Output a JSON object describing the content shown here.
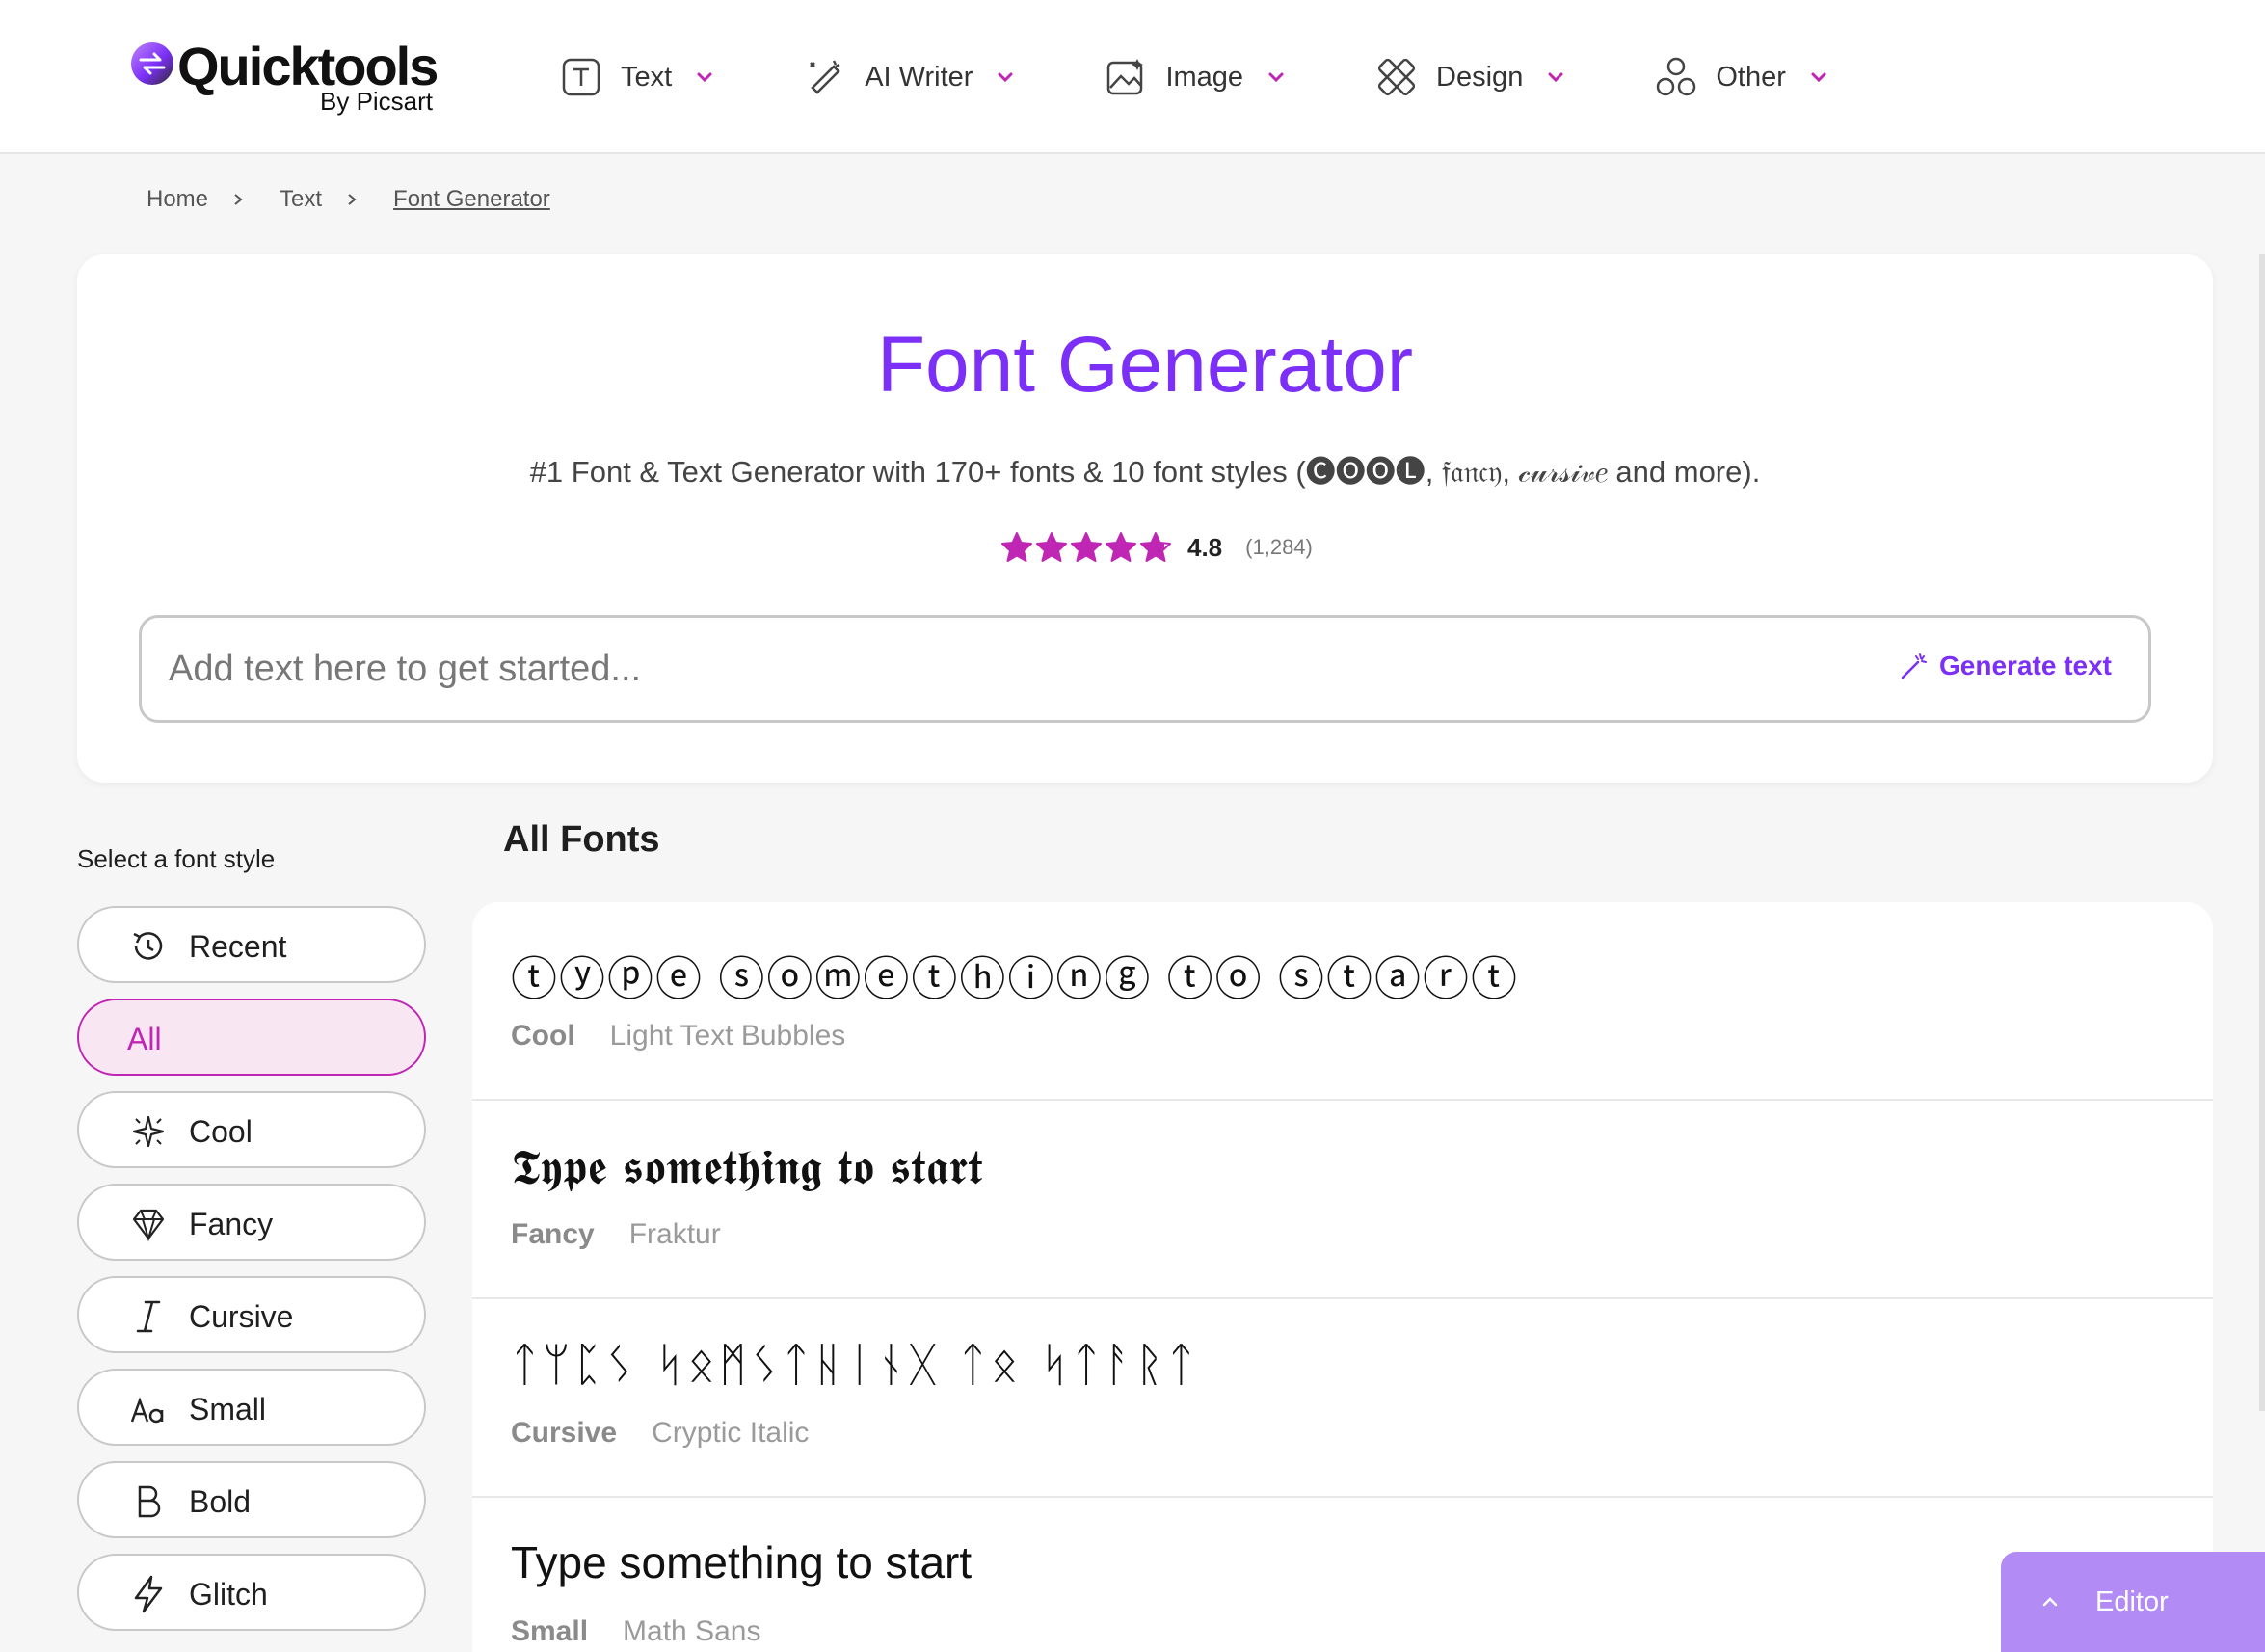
{
  "brand": {
    "name": "Quicktools",
    "sub": "By Picsart",
    "accent": "#7b2ff7",
    "pink": "#c026b4"
  },
  "nav": [
    {
      "label": "Text",
      "icon": "text-box-icon"
    },
    {
      "label": "AI Writer",
      "icon": "magic-pen-icon"
    },
    {
      "label": "Image",
      "icon": "image-icon"
    },
    {
      "label": "Design",
      "icon": "design-tools-icon"
    },
    {
      "label": "Other",
      "icon": "shapes-icon"
    }
  ],
  "breadcrumb": {
    "home": "Home",
    "text": "Text",
    "current": "Font Generator"
  },
  "hero": {
    "title": "Font Generator",
    "subtitle": "#1 Font & Text Generator with 170+ fonts & 10 font styles (🅒🅞🅞🅛, 𝔣𝔞𝔫𝔠𝔶, 𝒸𝓊𝓇𝓈𝒾𝓋𝑒 and more).",
    "rating": "4.8",
    "rating_stars": 4.8,
    "rating_count": "(1,284)",
    "placeholder": "Add text here to get started...",
    "generate": "Generate text"
  },
  "sidebar": {
    "title": "Select a font style",
    "items": [
      {
        "label": "Recent",
        "icon": "recent-icon",
        "active": false
      },
      {
        "label": "All",
        "icon": "",
        "active": true
      },
      {
        "label": "Cool",
        "icon": "sparkle-icon",
        "active": false
      },
      {
        "label": "Fancy",
        "icon": "diamond-icon",
        "active": false
      },
      {
        "label": "Cursive",
        "icon": "italic-icon",
        "active": false
      },
      {
        "label": "Small",
        "icon": "small-text-icon",
        "active": false
      },
      {
        "label": "Bold",
        "icon": "bold-icon",
        "active": false
      },
      {
        "label": "Glitch",
        "icon": "lightning-icon",
        "active": false
      }
    ]
  },
  "fonts": {
    "title": "All Fonts",
    "rows": [
      {
        "sample": "ⓣⓨⓟⓔ ⓢⓞⓜⓔⓣⓗⓘⓝⓖ ⓣⓞ ⓢⓣⓐⓡⓣ",
        "category": "Cool",
        "name": "Light Text Bubbles"
      },
      {
        "sample": "𝕿𝖞𝖕𝖊 𝖘𝖔𝖒𝖊𝖙𝖍𝖎𝖓𝖌 𝖙𝖔 𝖘𝖙𝖆𝖗𝖙",
        "category": "Fancy",
        "name": "Fraktur"
      },
      {
        "sample": "ᛏᛘᛈᛊ ᛋᛟᛗᛊᛏᚺᛁᚾᚷ ᛏᛟ ᛋᛏᚨᚱᛏ",
        "category": "Cursive",
        "name": "Cryptic Italic"
      },
      {
        "sample": "Type something to start",
        "category": "Small",
        "name": "Math Sans"
      }
    ]
  },
  "editor": {
    "label": "Editor"
  }
}
